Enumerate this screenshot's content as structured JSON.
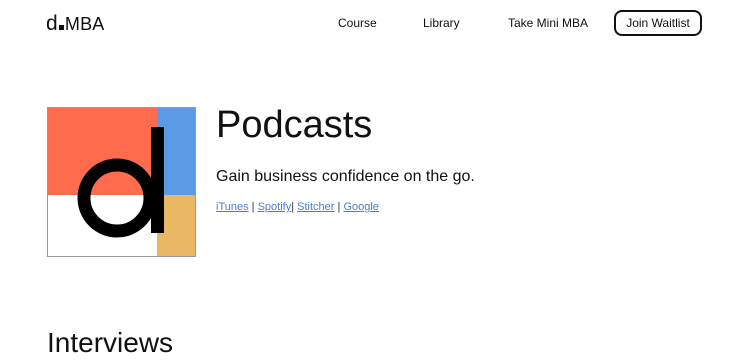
{
  "brand": {
    "letter": "d",
    "rest": "MBA"
  },
  "nav": {
    "course": "Course",
    "library": "Library",
    "mini_mba": "Take Mini MBA",
    "join": "Join Waitlist"
  },
  "cover": {
    "colors": {
      "red": "#ff6b4d",
      "blue": "#5b9be6",
      "yellow": "#e9b865",
      "white": "#ffffff",
      "letter": "#000000"
    },
    "icon": "d-letter-logo"
  },
  "hero": {
    "title": "Podcasts",
    "subtitle": "Gain business confidence on the go.",
    "links": [
      "iTunes",
      "Spotify",
      "Stitcher",
      "Google"
    ],
    "separator": "|"
  },
  "section": {
    "title": "Interviews"
  },
  "colors": {
    "link": "#4a7cd6",
    "text": "#111111"
  }
}
